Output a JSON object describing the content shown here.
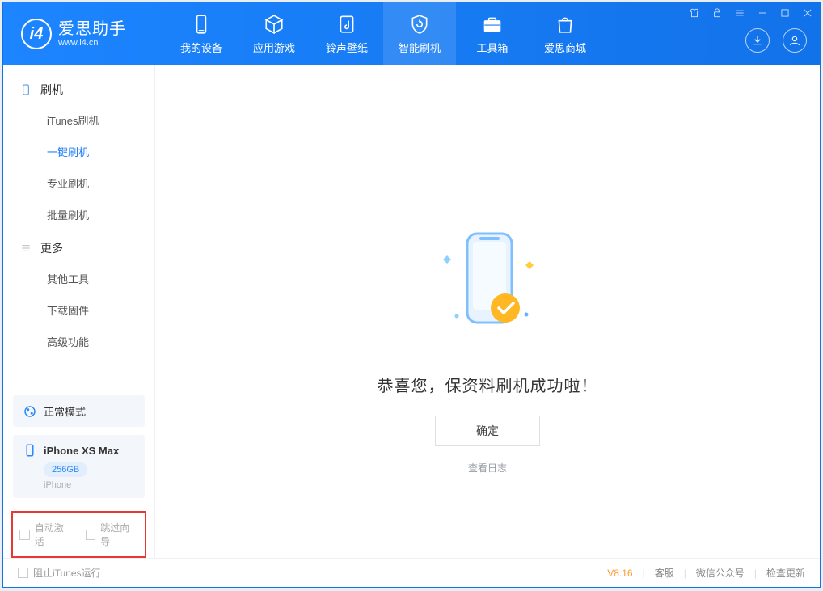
{
  "brand": {
    "title": "爱思助手",
    "sub": "www.i4.cn",
    "logo_letter": "i4"
  },
  "nav": {
    "tabs": [
      {
        "label": "我的设备"
      },
      {
        "label": "应用游戏"
      },
      {
        "label": "铃声壁纸"
      },
      {
        "label": "智能刷机"
      },
      {
        "label": "工具箱"
      },
      {
        "label": "爱思商城"
      }
    ],
    "active_index": 3
  },
  "sidebar": {
    "groups": [
      {
        "title": "刷机",
        "items": [
          "iTunes刷机",
          "一键刷机",
          "专业刷机",
          "批量刷机"
        ],
        "active_index": 1
      },
      {
        "title": "更多",
        "items": [
          "其他工具",
          "下载固件",
          "高级功能"
        ],
        "active_index": -1
      }
    ],
    "mode_card": {
      "label": "正常模式"
    },
    "device_card": {
      "name": "iPhone XS Max",
      "storage": "256GB",
      "type": "iPhone"
    },
    "checkboxes": {
      "auto_activate": "自动激活",
      "skip_guide": "跳过向导"
    }
  },
  "main": {
    "success_text": "恭喜您，保资料刷机成功啦！",
    "ok_label": "确定",
    "log_link": "查看日志"
  },
  "footer": {
    "block_itunes": "阻止iTunes运行",
    "version": "V8.16",
    "links": [
      "客服",
      "微信公众号",
      "检查更新"
    ]
  }
}
